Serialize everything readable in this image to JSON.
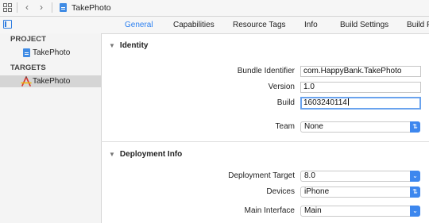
{
  "jumpbar": {
    "title": "TakePhoto"
  },
  "tabs": [
    {
      "label": "General",
      "active": true
    },
    {
      "label": "Capabilities"
    },
    {
      "label": "Resource Tags"
    },
    {
      "label": "Info"
    },
    {
      "label": "Build Settings"
    },
    {
      "label": "Build F"
    }
  ],
  "navigator": {
    "project_header": "PROJECT",
    "project_item": "TakePhoto",
    "targets_header": "TARGETS",
    "target_item": "TakePhoto"
  },
  "identity": {
    "header": "Identity",
    "bundle_id_label": "Bundle Identifier",
    "bundle_id_value": "com.HappyBank.TakePhoto",
    "version_label": "Version",
    "version_value": "1.0",
    "build_label": "Build",
    "build_value": "1603240114",
    "team_label": "Team",
    "team_value": "None"
  },
  "deployment": {
    "header": "Deployment Info",
    "target_label": "Deployment Target",
    "target_value": "8.0",
    "devices_label": "Devices",
    "devices_value": "iPhone",
    "main_interface_label": "Main Interface",
    "main_interface_value": "Main"
  },
  "colors": {
    "accent": "#2a7ff0",
    "popup_button": "#3d87ee",
    "selection": "#d5d5d5"
  }
}
